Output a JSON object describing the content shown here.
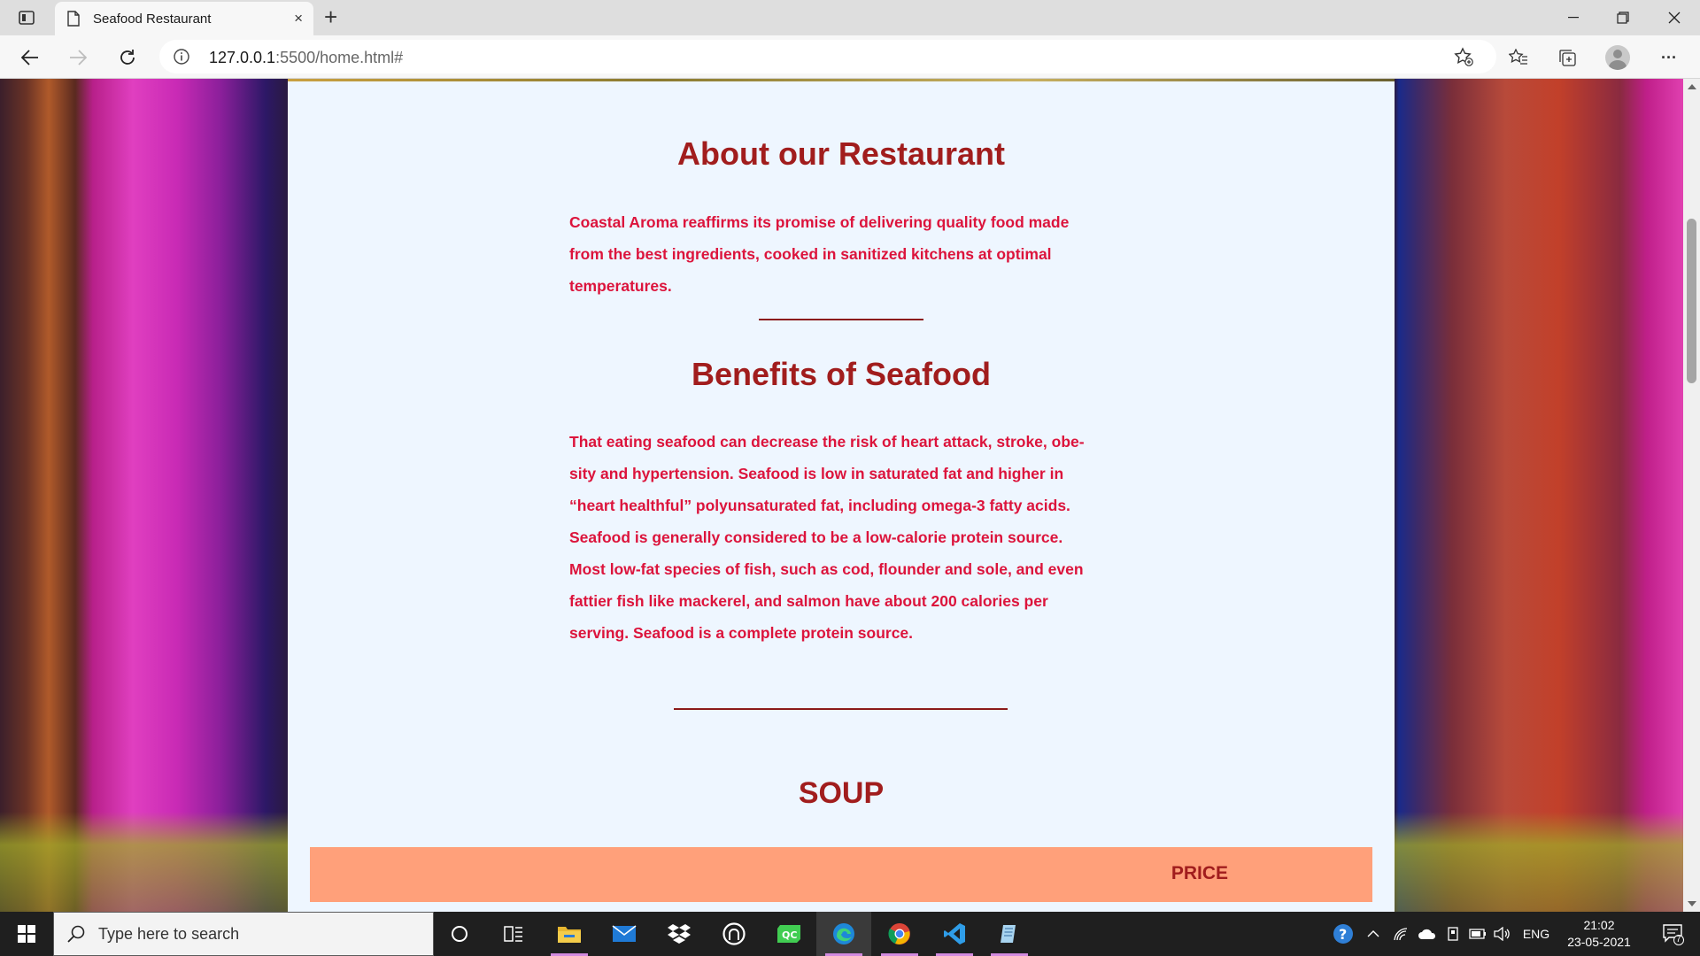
{
  "browser": {
    "tab_title": "Seafood Restaurant",
    "tab_close": "×",
    "new_tab": "+",
    "url_host": "127.0.0.1",
    "url_rest": ":5500/home.html#",
    "more": "···"
  },
  "page": {
    "about_heading": "About our Restaurant",
    "about_text": "Coastal Aroma reaffirms its promise of delivering quality food made from the best ingredients, cooked in sanitized kitchens at optimal temperatures.",
    "benefits_heading": "Benefits of Seafood",
    "benefits_text": "That eating seafood can decrease the risk of heart attack, stroke, obe- sity and hypertension. Seafood is low in saturated fat and higher in “heart healthful” polyunsaturated fat, including omega-3 fatty acids. Seafood is generally considered to be a low-calorie protein source. Most low-fat species of fish, such as cod, flounder and sole, and even fattier fish like mackerel, and salmon have about 200 calories per serving. Seafood is a complete protein source.",
    "soup_heading": "SOUP",
    "price_label": "PRICE"
  },
  "taskbar": {
    "search_placeholder": "Type here to search",
    "language": "ENG",
    "time": "21:02",
    "date": "23-05-2021",
    "notification_count": "7"
  },
  "colors": {
    "heading": "#a11d1d",
    "paragraph": "#dc143c",
    "page_bg": "#eef6ff",
    "price_bar": "#ffa07a"
  }
}
